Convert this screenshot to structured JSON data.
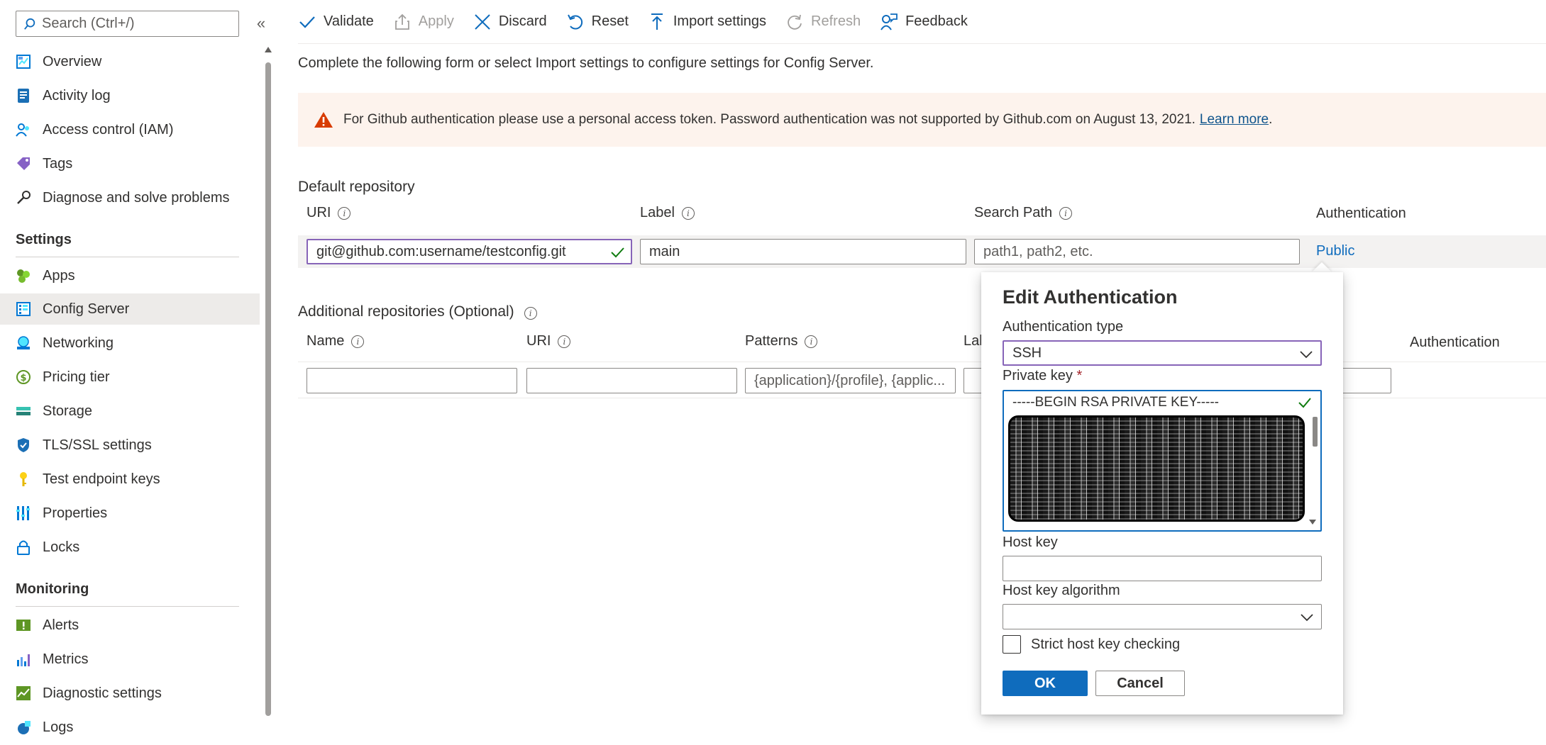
{
  "search": {
    "placeholder": "Search (Ctrl+/)"
  },
  "sidebar": {
    "collapse_label": "«",
    "items_top": [
      {
        "label": "Overview",
        "icon": "overview-icon"
      },
      {
        "label": "Activity log",
        "icon": "activity-log-icon"
      },
      {
        "label": "Access control (IAM)",
        "icon": "people-icon"
      },
      {
        "label": "Tags",
        "icon": "tag-icon"
      },
      {
        "label": "Diagnose and solve problems",
        "icon": "wrench-icon"
      }
    ],
    "settings_title": "Settings",
    "settings_items": [
      {
        "label": "Apps",
        "icon": "apps-icon"
      },
      {
        "label": "Config Server",
        "icon": "config-server-icon",
        "selected": true
      },
      {
        "label": "Networking",
        "icon": "networking-icon"
      },
      {
        "label": "Pricing tier",
        "icon": "pricing-icon"
      },
      {
        "label": "Storage",
        "icon": "storage-icon"
      },
      {
        "label": "TLS/SSL settings",
        "icon": "shield-icon"
      },
      {
        "label": "Test endpoint keys",
        "icon": "key-icon"
      },
      {
        "label": "Properties",
        "icon": "properties-icon"
      },
      {
        "label": "Locks",
        "icon": "lock-icon"
      }
    ],
    "monitoring_title": "Monitoring",
    "monitoring_items": [
      {
        "label": "Alerts",
        "icon": "alert-icon"
      },
      {
        "label": "Metrics",
        "icon": "metrics-icon"
      },
      {
        "label": "Diagnostic settings",
        "icon": "diagnostic-icon"
      },
      {
        "label": "Logs",
        "icon": "logs-icon"
      }
    ]
  },
  "toolbar": {
    "validate": "Validate",
    "apply": "Apply",
    "discard": "Discard",
    "reset": "Reset",
    "import": "Import settings",
    "refresh": "Refresh",
    "feedback": "Feedback"
  },
  "main": {
    "intro": "Complete the following form or select Import settings to configure settings for Config Server.",
    "banner_text": "For Github authentication please use a personal access token. Password authentication was not supported by Github.com on August 13, 2021.",
    "banner_link": "Learn more",
    "banner_period": ".",
    "default_repo": {
      "title": "Default repository",
      "col_uri": "URI",
      "col_label": "Label",
      "col_search_path": "Search Path",
      "col_auth": "Authentication",
      "uri_value": "git@github.com:username/testconfig.git",
      "label_value": "main",
      "search_path_placeholder": "path1, path2, etc.",
      "auth_value": "Public"
    },
    "additional_repo": {
      "title": "Additional repositories (Optional)",
      "col_name": "Name",
      "col_uri": "URI",
      "col_patterns": "Patterns",
      "col_label_partial": "Lal",
      "col_auth": "Authentication",
      "patterns_placeholder": "{application}/{profile}, {applic..."
    }
  },
  "popup": {
    "title": "Edit Authentication",
    "auth_type_label": "Authentication type",
    "auth_type_value": "SSH",
    "private_key_label": "Private key",
    "required_mark": "*",
    "private_key_first_line": "-----BEGIN RSA PRIVATE KEY-----",
    "host_key_label": "Host key",
    "host_key_algorithm_label": "Host key algorithm",
    "strict_label": "Strict host key checking",
    "ok": "OK",
    "cancel": "Cancel"
  },
  "colors": {
    "accent": "#0f6cbd",
    "focus_border": "#8764b8",
    "warning": "#d83b01",
    "banner_bg": "#fdf3ed",
    "valid_check": "#107c10"
  }
}
